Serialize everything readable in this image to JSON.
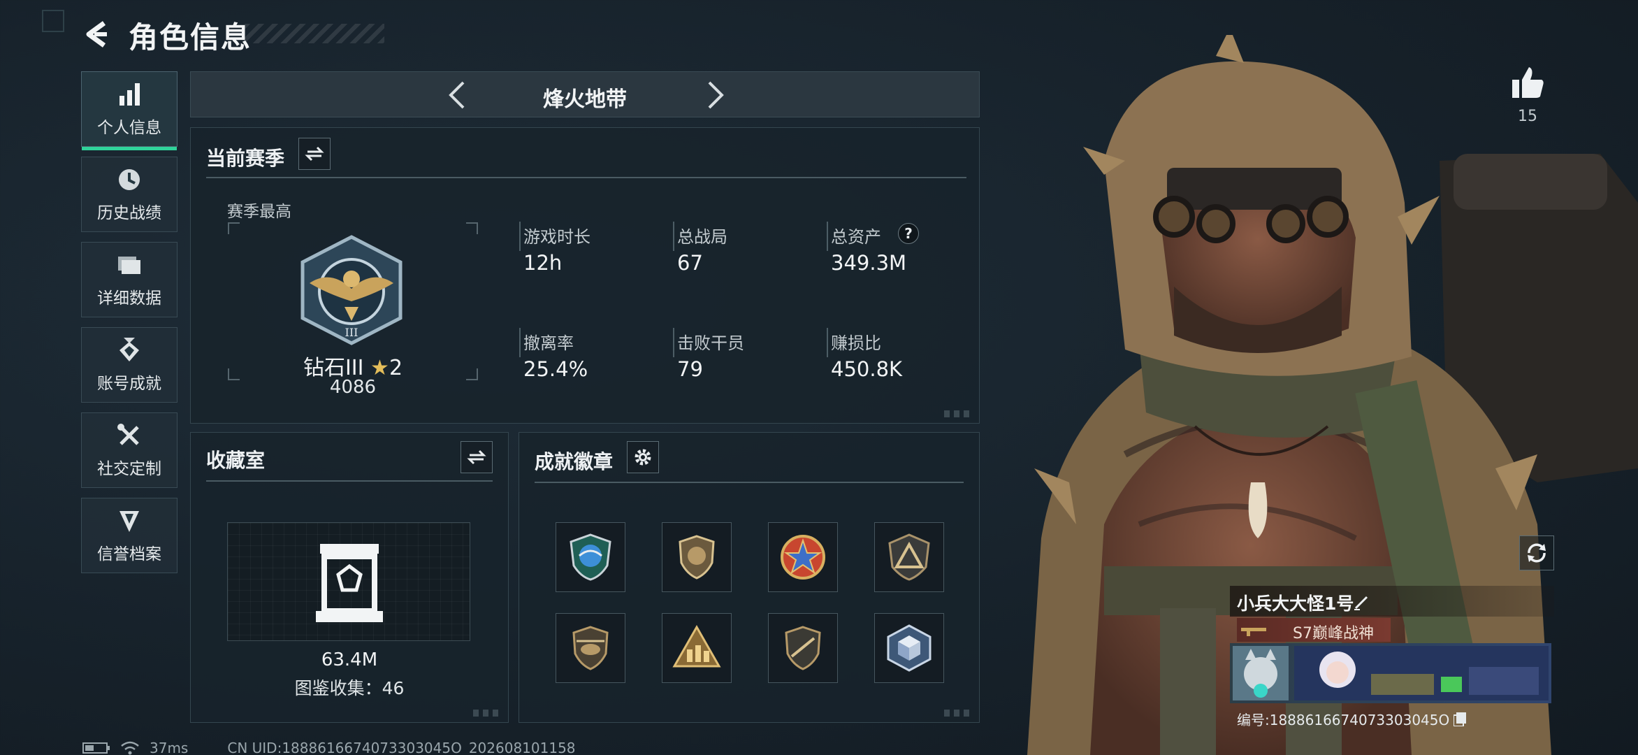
{
  "header": {
    "title": "角色信息"
  },
  "sidebar": {
    "items": [
      {
        "label": "个人信息",
        "icon": "bar-chart-icon",
        "active": true
      },
      {
        "label": "历史战绩",
        "icon": "clock-history-icon",
        "active": false
      },
      {
        "label": "详细数据",
        "icon": "folder-icon",
        "active": false
      },
      {
        "label": "账号成就",
        "icon": "medal-icon",
        "active": false
      },
      {
        "label": "社交定制",
        "icon": "tools-icon",
        "active": false
      },
      {
        "label": "信誉档案",
        "icon": "reputation-icon",
        "active": false
      }
    ]
  },
  "mode": {
    "label": "烽火地带"
  },
  "season": {
    "title": "当前赛季",
    "best_label": "赛季最高",
    "rank_name": "钻石III",
    "rank_stars": "2",
    "rank_score": "4086",
    "stats": [
      {
        "label": "游戏时长",
        "value": "12h"
      },
      {
        "label": "总战局",
        "value": "67"
      },
      {
        "label": "总资产",
        "value": "349.3M"
      },
      {
        "label": "撤离率",
        "value": "25.4%"
      },
      {
        "label": "击败干员",
        "value": "79"
      },
      {
        "label": "赚损比",
        "value": "450.8K"
      }
    ],
    "help_glyph": "?"
  },
  "collection": {
    "title": "收藏室",
    "value": "63.4M",
    "count_label": "图鉴收集：46"
  },
  "achievements": {
    "title": "成就徽章",
    "badges": [
      {
        "icon": "globe-shield-badge-icon",
        "color": "#3d8fd8"
      },
      {
        "icon": "lion-shield-badge-icon",
        "color": "#b79a68"
      },
      {
        "icon": "star-emblem-badge-icon",
        "color": "#c8462f"
      },
      {
        "icon": "triangle-badge-icon",
        "color": "#a9926a"
      },
      {
        "icon": "helicopter-badge-icon",
        "color": "#b79a68"
      },
      {
        "icon": "soldiers-badge-icon",
        "color": "#caa768"
      },
      {
        "icon": "rifle-shield-badge-icon",
        "color": "#b79a68"
      },
      {
        "icon": "cube-badge-icon",
        "color": "#8fa6c8"
      }
    ]
  },
  "profile": {
    "likes": "15",
    "player_name": "小兵大大怪1号",
    "title_badge": "S7巅峰战神",
    "id_label": "编号:1888616674073303045O"
  },
  "status": {
    "ping": "37ms",
    "uid": "CN UID:1888616674073303045O_202608101158"
  },
  "colors": {
    "accent": "#2fd39a",
    "panel": "#18232b",
    "gold": "#c9a35c"
  }
}
